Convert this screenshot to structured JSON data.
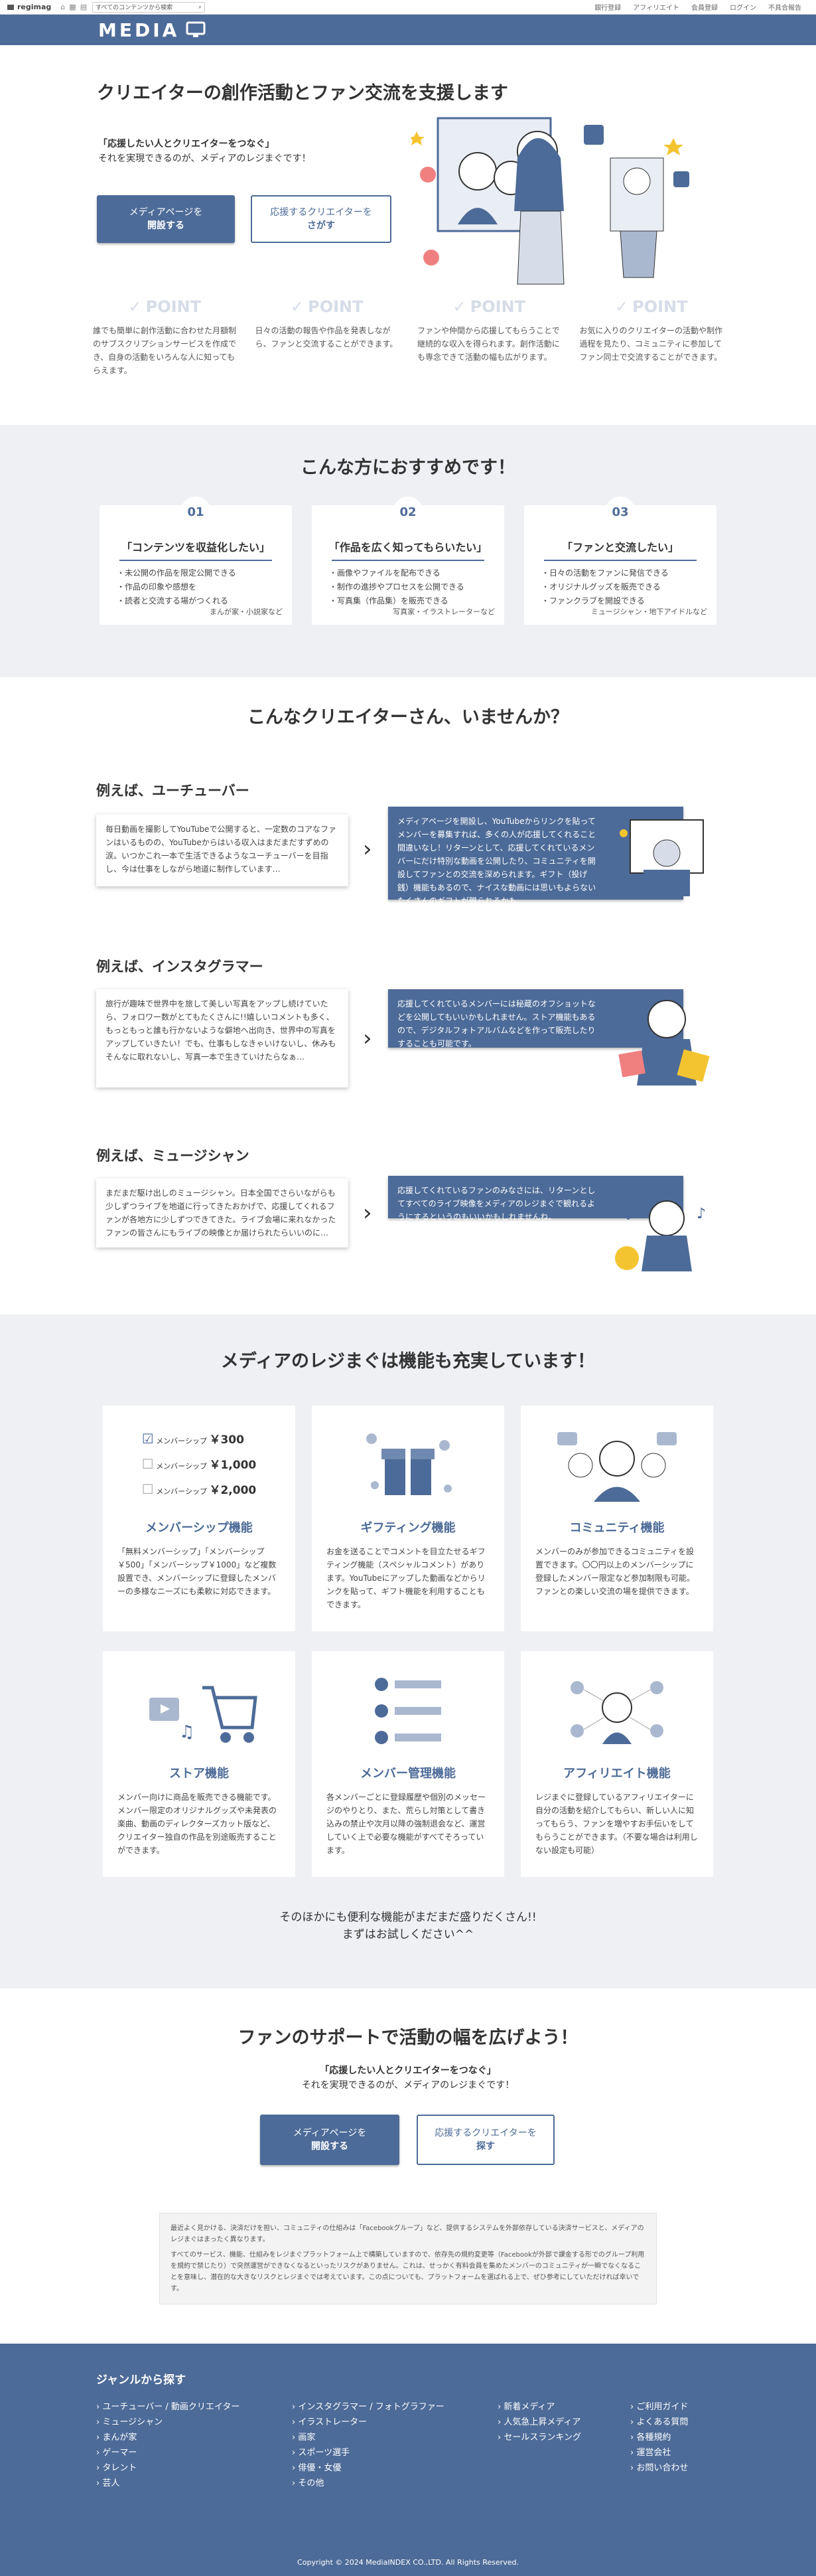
{
  "topbar": {
    "brand": "regimag",
    "search_placeholder": "すべてのコンテンツから検索",
    "links": [
      "銀行登録",
      "アフィリエイト",
      "会員登録",
      "ログイン",
      "不具合報告"
    ]
  },
  "header": {
    "logo": "MEDIA"
  },
  "hero": {
    "title": "クリエイターの創作活動とファン交流を支援します",
    "lead_line1": "「応援したい人とクリエイターをつなぐ」",
    "lead_line2": "それを実現できるのが、メディアのレジまぐです！",
    "btn_open_1": "メディアページを",
    "btn_open_2": "開設する",
    "btn_find_1": "応援するクリエイターを",
    "btn_find_2": "さがす"
  },
  "points": {
    "label": "POINT",
    "items": [
      "誰でも簡単に創作活動に合わせた月額制のサブスクリプションサービスを作成でき、自身の活動をいろんな人に知ってもらえます。",
      "日々の活動の報告や作品を発表しながら、ファンと交流することができます。",
      "ファンや仲間から応援してもらうことで継続的な収入を得られます。創作活動にも専念できて活動の幅も広がります。",
      "お気に入りのクリエイターの活動や制作過程を見たり、コミュニティに参加してファン同士で交流することができます。"
    ]
  },
  "recommend": {
    "title": "こんな方におすすめです！",
    "cards": [
      {
        "num": "01",
        "title": "「コンテンツを収益化したい」",
        "items": [
          "・未公開の作品を限定公開できる",
          "・作品の印象や感想を",
          "・読者と交流する場がつくれる"
        ],
        "who": "まんが家・小説家など"
      },
      {
        "num": "02",
        "title": "「作品を広く知ってもらいたい」",
        "items": [
          "・画像やファイルを配布できる",
          "・制作の進捗やプロセスを公開できる",
          "・写真集（作品集）を販売できる"
        ],
        "who": "写真家・イラストレーターなど"
      },
      {
        "num": "03",
        "title": "「ファンと交流したい」",
        "items": [
          "・日々の活動をファンに発信できる",
          "・オリジナルグッズを販売できる",
          "・ファンクラブを開設できる"
        ],
        "who": "ミュージシャン・地下アイドルなど"
      }
    ]
  },
  "creators": {
    "title": "こんなクリエイターさん、いませんか？",
    "examples": [
      {
        "heading": "例えば、ユーチューバー",
        "problem": "毎日動画を撮影してYouTubeで公開すると、一定数のコアなファンはいるものの、YouTubeからはいる収入はまだまだすずめの涙。いつかこれ一本で生活できるようなユーチューバーを目指し、今は仕事をしながら地道に制作しています…",
        "solution": "メディアページを開設し、YouTubeからリンクを貼ってメンバーを募集すれば、多くの人が応援してくれること間違いなし！リターンとして、応援してくれているメンバーにだけ特別な動画を公開したり、コミュニティを開設してファンとの交流を深められます。ギフト（投げ銭）機能もあるので、ナイスな動画には思いもよらないたくさんのギフトが贈られるかも。"
      },
      {
        "heading": "例えば、インスタグラマー",
        "problem": "旅行が趣味で世界中を旅して美しい写真をアップし続けていたら、フォロワー数がとてもたくさんに!!嬉しいコメントも多く、もっともっと誰も行かないような僻地へ出向き、世界中の写真をアップしていきたい！でも、仕事もしなきゃいけないし、休みもそんなに取れないし、写真一本で生きていけたらなぁ…",
        "solution": "応援してくれているメンバーには秘蔵のオフショットなどを公開してもいいかもしれません。ストア機能もあるので、デジタルフォトアルバムなどを作って販売したりすることも可能です。"
      },
      {
        "heading": "例えば、ミュージシャン",
        "problem": "まだまだ駆け出しのミュージシャン。日本全国でさらいながらも少しずつライブを地道に行ってきたおかげで、応援してくれるファンが各地方に少しずつできてきた。ライブ会場に来れなかったファンの皆さんにもライブの映像とか届けられたらいいのに…",
        "solution": "応援してくれているファンのみなさには、リターンとしてすべてのライブ映像をメディアのレジまぐで観れるようにするというのもいいかもしれませんね。"
      }
    ]
  },
  "features": {
    "title": "メディアのレジまぐは機能も充実しています！",
    "membership_rows": [
      {
        "label": "メンバーシップ",
        "price": "￥300"
      },
      {
        "label": "メンバーシップ",
        "price": "￥1,000"
      },
      {
        "label": "メンバーシップ",
        "price": "￥2,000"
      }
    ],
    "items": [
      {
        "title": "メンバーシップ機能",
        "desc": "「無料メンバーシップ」「メンバーシップ￥500」「メンバーシップ￥1000」など複数設置でき、メンバーシップに登録したメンバーの多様なニーズにも柔軟に対応できます。"
      },
      {
        "title": "ギフティング機能",
        "desc": "お金を送ることでコメントを目立たせるギフティング機能（スペシャルコメント）があります。YouTubeにアップした動画などからリンクを貼って、ギフト機能を利用することもできます。"
      },
      {
        "title": "コミュニティ機能",
        "desc": "メンバーのみが参加できるコミュニティを設置できます。〇〇円以上のメンバーシップに登録したメンバー限定など参加制限も可能。ファンとの楽しい交流の場を提供できます。"
      },
      {
        "title": "ストア機能",
        "desc": "メンバー向けに商品を販売できる機能です。メンバー限定のオリジナルグッズや未発表の楽曲、動画のディレクターズカット版など、クリエイター独自の作品を別途販売することができます。"
      },
      {
        "title": "メンバー管理機能",
        "desc": "各メンバーごとに登録履歴や個別のメッセージのやりとり、また、荒らし対策として書き込みの禁止や次月以降の強制退会など、運営していく上で必要な機能がすべてそろっています。"
      },
      {
        "title": "アフィリエイト機能",
        "desc": "レジまぐに登録しているアフィリエイターに自分の活動を紹介してもらい、新しい人に知ってもらう、ファンを増やすお手伝いをしてもらうことができます。（不要な場合は利用しない設定も可能）"
      }
    ],
    "more_line1": "そのほかにも便利な機能がまだまだ盛りだくさん!!",
    "more_line2": "まずはお試しください^^"
  },
  "support": {
    "title": "ファンのサポートで活動の幅を広げよう！",
    "lead_line1": "「応援したい人とクリエイターをつなぐ」",
    "lead_line2": "それを実現できるのが、メディアのレジまぐです！",
    "btn_open_1": "メディアページを",
    "btn_open_2": "開設する",
    "btn_find_1": "応援するクリエイターを",
    "btn_find_2": "探す",
    "notice_1": "最近よく見かける、決済だけを担い、コミュニティの仕組みは「Facebookグループ」など、提供するシステムを外部依存している決済サービスと、メディアのレジまぐはまったく異なります。",
    "notice_2": "すべてのサービス、機能、仕組みをレジまぐプラットフォーム上で構築していますので、依存先の規約変更等（Facebookが外部で課金する形でのグループ利用を規約で禁じたり）で突然運営ができなくなるといったリスクがありません。これは、せっかく有料会員を集めたメンバーのコミュニティが一瞬でなくなることを意味し、潜在的な大きなリスクとレジまぐでは考えています。この点についても、プラットフォームを選ばれる上で、ぜひ参考にしていただければ幸いです。"
  },
  "footer": {
    "title": "ジャンルから探す",
    "cols": [
      [
        "ユーチューバー / 動画クリエイター",
        "ミュージシャン",
        "まんが家",
        "ゲーマー",
        "タレント",
        "芸人"
      ],
      [
        "インスタグラマー / フォトグラファー",
        "イラストレーター",
        "画家",
        "スポーツ選手",
        "俳優・女優",
        "その他"
      ],
      [
        "新着メディア",
        "人気急上昇メディア",
        "セールスランキング"
      ],
      [
        "ご利用ガイド",
        "よくある質問",
        "各種規約",
        "運営会社",
        "お問い合わせ"
      ]
    ],
    "copyright": "Copyright © 2024 MediaINDEX CO.,LTD. All Rights Reserved."
  },
  "colors": {
    "accent": "#4d6b98",
    "section_bg": "#eef0f4"
  }
}
